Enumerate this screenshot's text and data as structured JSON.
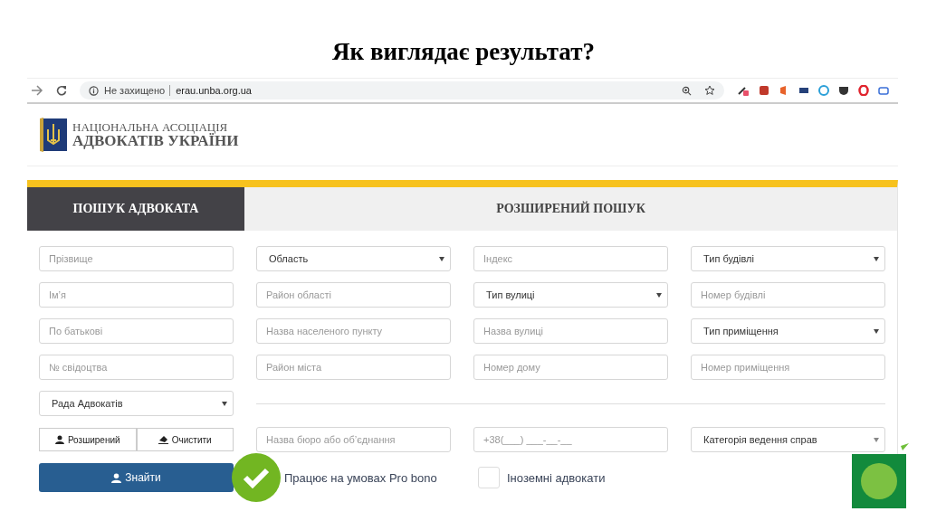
{
  "slide_title": "Як виглядає результат?",
  "browser": {
    "security": "Не захищено",
    "url": "erau.unba.org.ua"
  },
  "logo": {
    "line1": "НАЦІОНАЛЬНА АСОЦІАЦІЯ",
    "line2": "АДВОКАТІВ УКРАЇНИ"
  },
  "tabs": [
    {
      "label": "ПОШУК АДВОКАТА",
      "selected": true
    },
    {
      "label": "РОЗШИРЕНИЙ ПОШУК",
      "selected": false
    }
  ],
  "grid": [
    [
      {
        "kind": "input",
        "placeholder": "Прізвище"
      },
      {
        "kind": "select",
        "value": "Область"
      },
      {
        "kind": "input",
        "placeholder": "Індекс"
      },
      {
        "kind": "select",
        "value": "Тип будівлі"
      }
    ],
    [
      {
        "kind": "input",
        "placeholder": "Ім’я"
      },
      {
        "kind": "input",
        "placeholder": "Район області"
      },
      {
        "kind": "select",
        "value": "Тип вулиці"
      },
      {
        "kind": "input",
        "placeholder": "Номер будівлі"
      }
    ],
    [
      {
        "kind": "input",
        "placeholder": "По батькові"
      },
      {
        "kind": "input",
        "placeholder": "Назва населеного пункту"
      },
      {
        "kind": "input",
        "placeholder": "Назва вулиці"
      },
      {
        "kind": "select",
        "value": "Тип приміщення"
      }
    ],
    [
      {
        "kind": "input",
        "placeholder": "№ свідоцтва"
      },
      {
        "kind": "input",
        "placeholder": "Район міста"
      },
      {
        "kind": "input",
        "placeholder": "Номер дому"
      },
      {
        "kind": "input",
        "placeholder": "Номер приміщення"
      }
    ]
  ],
  "council": {
    "value": "Рада Адвокатів"
  },
  "actions": [
    {
      "label": "Розширений"
    },
    {
      "label": "Очистити"
    }
  ],
  "lower": [
    {
      "kind": "input",
      "placeholder": "Назва бюро або об’єднання"
    },
    {
      "kind": "input",
      "placeholder": "+38(___) ___-__-__"
    },
    {
      "kind": "select",
      "value": "Категорія ведення справ"
    }
  ],
  "find_button": "Знайти",
  "checkboxes": [
    {
      "label": "Працює на умовах Pro bono",
      "checked": true
    },
    {
      "label": "Іноземні адвокати",
      "checked": false
    }
  ]
}
